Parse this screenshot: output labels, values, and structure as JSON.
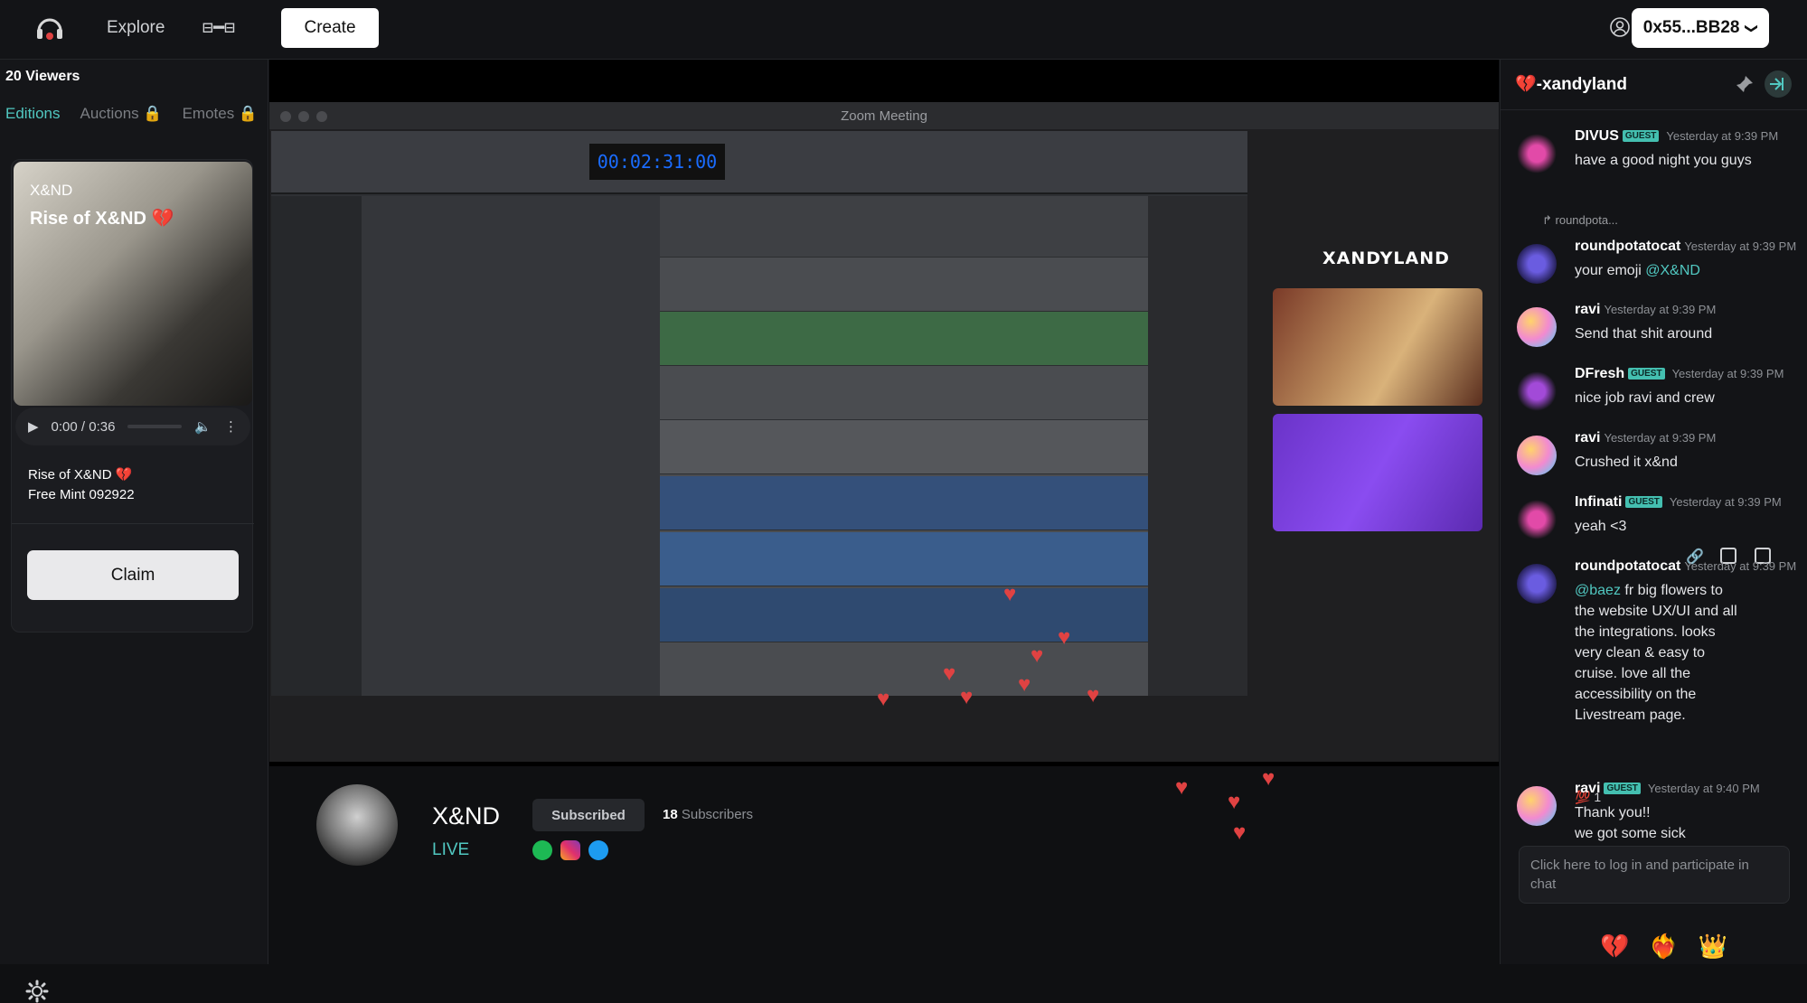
{
  "topbar": {
    "explore_label": "Explore",
    "toggle_glyph": "⊟━⊟",
    "create_label": "Create",
    "wallet_label": "0x55...BB28",
    "wallet_chevron": "❯"
  },
  "left": {
    "viewers": "20 Viewers",
    "tabs": [
      "Editions",
      "Auctions 🔒",
      "Emotes 🔒"
    ],
    "nft": {
      "artist": "X&ND",
      "title": "Rise of X&ND 💔",
      "audio_time": "0:00 / 0:36",
      "edition_line1": "Rise of X&ND 💔",
      "edition_line2": "Free Mint 092922",
      "claim_label": "Claim"
    }
  },
  "video": {
    "zoom_title": "Zoom Meeting",
    "daw_counter": "00:02:31:00",
    "brand": "XANDYLAND"
  },
  "channel": {
    "name": "X&ND",
    "status": "LIVE",
    "subscribed_label": "Subscribed",
    "subscriber_count": "18",
    "subscribers_label": "Subscribers"
  },
  "chat": {
    "title": "💔-xandyland",
    "guest_badge": "GUEST",
    "messages": [
      {
        "user": "DIVUS",
        "guest": true,
        "time": "Yesterday at 9:39 PM",
        "text": "have a good night you guys"
      },
      {
        "user": "roundpotatocat",
        "guest": false,
        "time": "Yesterday at 9:39 PM",
        "text": "your emoji ",
        "mention": "@X&ND"
      },
      {
        "user": "ravi",
        "guest": false,
        "time": "Yesterday at 9:39 PM",
        "text": "Send that shit around"
      },
      {
        "user": "DFresh",
        "guest": true,
        "time": "Yesterday at 9:39 PM",
        "text": "nice job ravi and crew"
      },
      {
        "user": "ravi",
        "guest": false,
        "time": "Yesterday at 9:39 PM",
        "text": "Crushed it x&nd"
      },
      {
        "user": "Infinati",
        "guest": true,
        "time": "Yesterday at 9:39 PM",
        "text": "yeah <3"
      },
      {
        "user": "roundpotatocat",
        "guest": false,
        "time": "Yesterday at 9:39 PM",
        "mention": "@baez",
        "text": " fr big flowers to the website UX/UI and all the integrations. looks very clean & easy to cruise. love all the accessibility on the Livestream page."
      },
      {
        "user": "ravi",
        "guest": true,
        "time": "Yesterday at 9:40 PM",
        "text": "Thank you!!",
        "text2": "we got some sick"
      }
    ],
    "reply_preview": "roundpota...",
    "reaction": "💯 1",
    "input_placeholder": "Click here to log in and participate in chat",
    "emoji_bar": [
      "💔",
      "❤️‍🔥",
      "👑"
    ]
  },
  "colors": {
    "accent": "#51c8c1",
    "guest_badge": "#44bfb0",
    "background": "#0f1012"
  }
}
